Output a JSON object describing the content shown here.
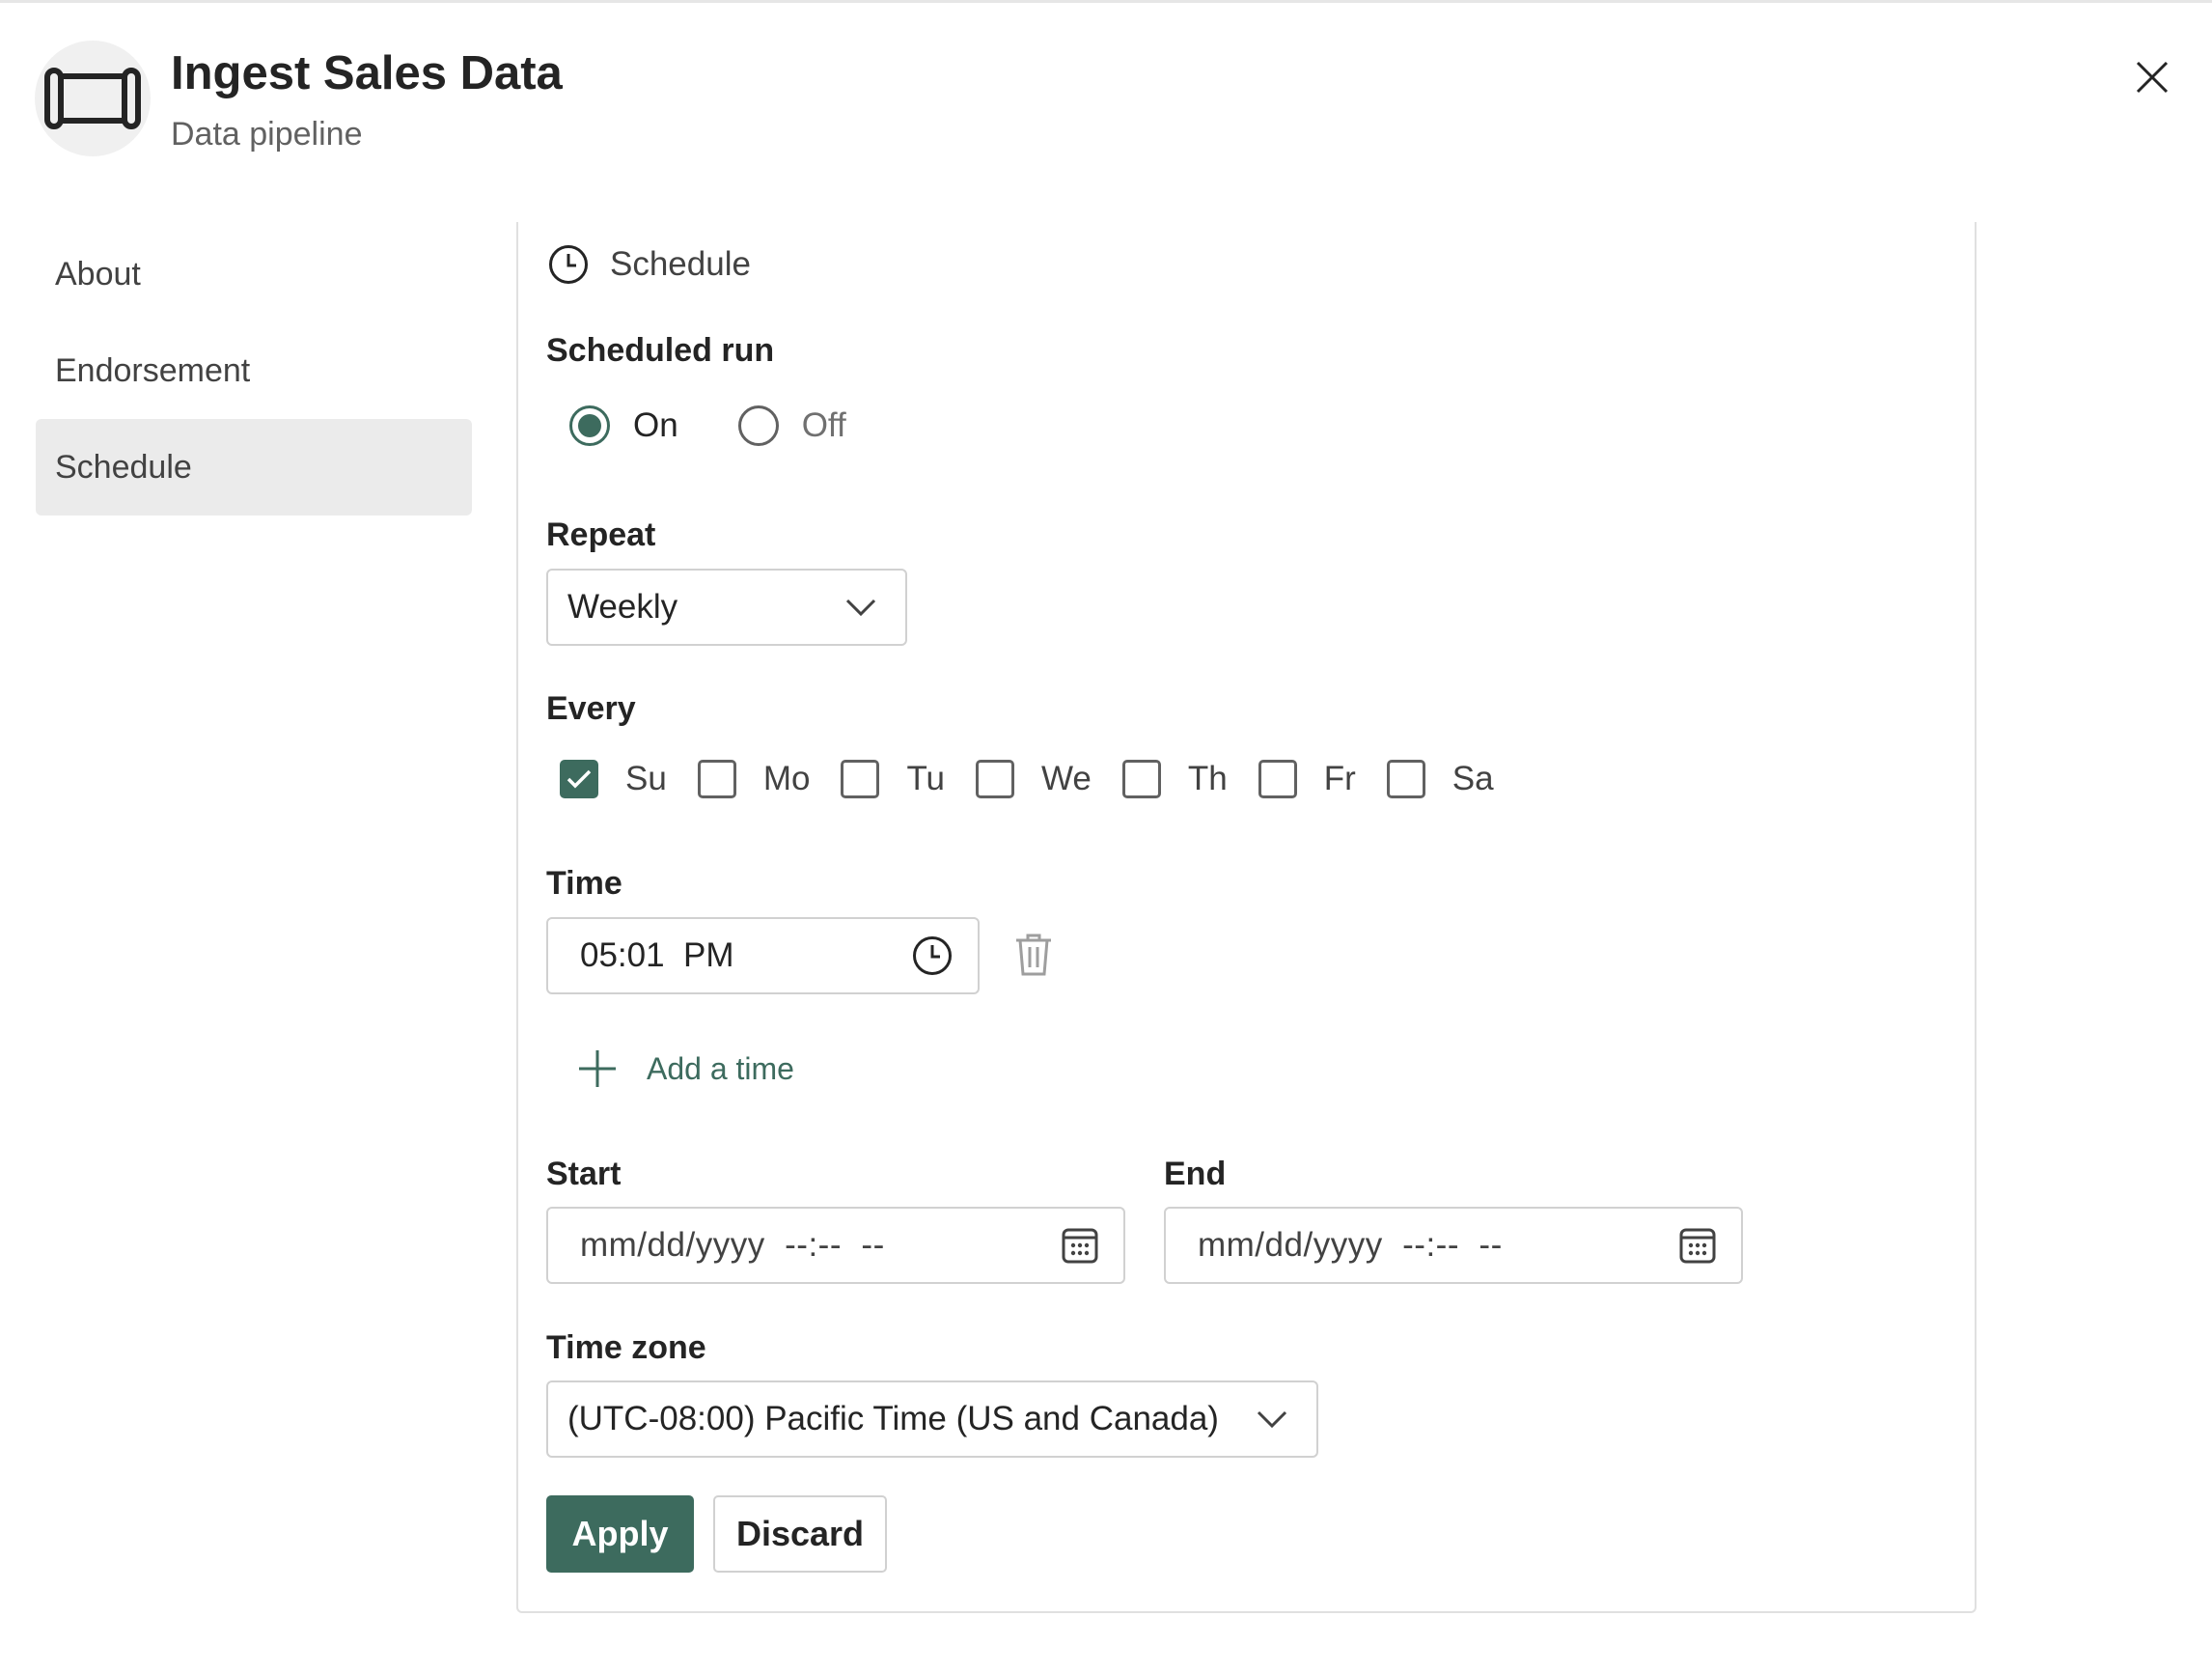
{
  "header": {
    "title": "Ingest Sales Data",
    "subtitle": "Data pipeline",
    "icon": "pipeline-icon",
    "close_icon": "close-icon"
  },
  "sidebar": {
    "items": [
      {
        "label": "About",
        "active": false
      },
      {
        "label": "Endorsement",
        "active": false
      },
      {
        "label": "Schedule",
        "active": true
      }
    ]
  },
  "schedule": {
    "section_title": "Schedule",
    "section_icon": "clock-icon",
    "scheduled_run": {
      "label": "Scheduled run",
      "options": [
        {
          "label": "On",
          "selected": true
        },
        {
          "label": "Off",
          "selected": false
        }
      ]
    },
    "repeat": {
      "label": "Repeat",
      "value": "Weekly"
    },
    "every": {
      "label": "Every",
      "days": [
        {
          "label": "Su",
          "checked": true
        },
        {
          "label": "Mo",
          "checked": false
        },
        {
          "label": "Tu",
          "checked": false
        },
        {
          "label": "We",
          "checked": false
        },
        {
          "label": "Th",
          "checked": false
        },
        {
          "label": "Fr",
          "checked": false
        },
        {
          "label": "Sa",
          "checked": false
        }
      ]
    },
    "time": {
      "label": "Time",
      "value": "05:01  PM",
      "delete_icon": "trash-icon"
    },
    "add_time_label": "Add a time",
    "start": {
      "label": "Start",
      "placeholder": "mm/dd/yyyy  --:--  --"
    },
    "end": {
      "label": "End",
      "placeholder": "mm/dd/yyyy  --:--  --"
    },
    "time_zone": {
      "label": "Time zone",
      "value": "(UTC-08:00) Pacific Time (US and Canada)"
    },
    "buttons": {
      "apply": "Apply",
      "discard": "Discard"
    }
  },
  "colors": {
    "accent": "#3d6b5e",
    "border": "#d1d1d1",
    "nav_active_bg": "#ebebeb"
  }
}
